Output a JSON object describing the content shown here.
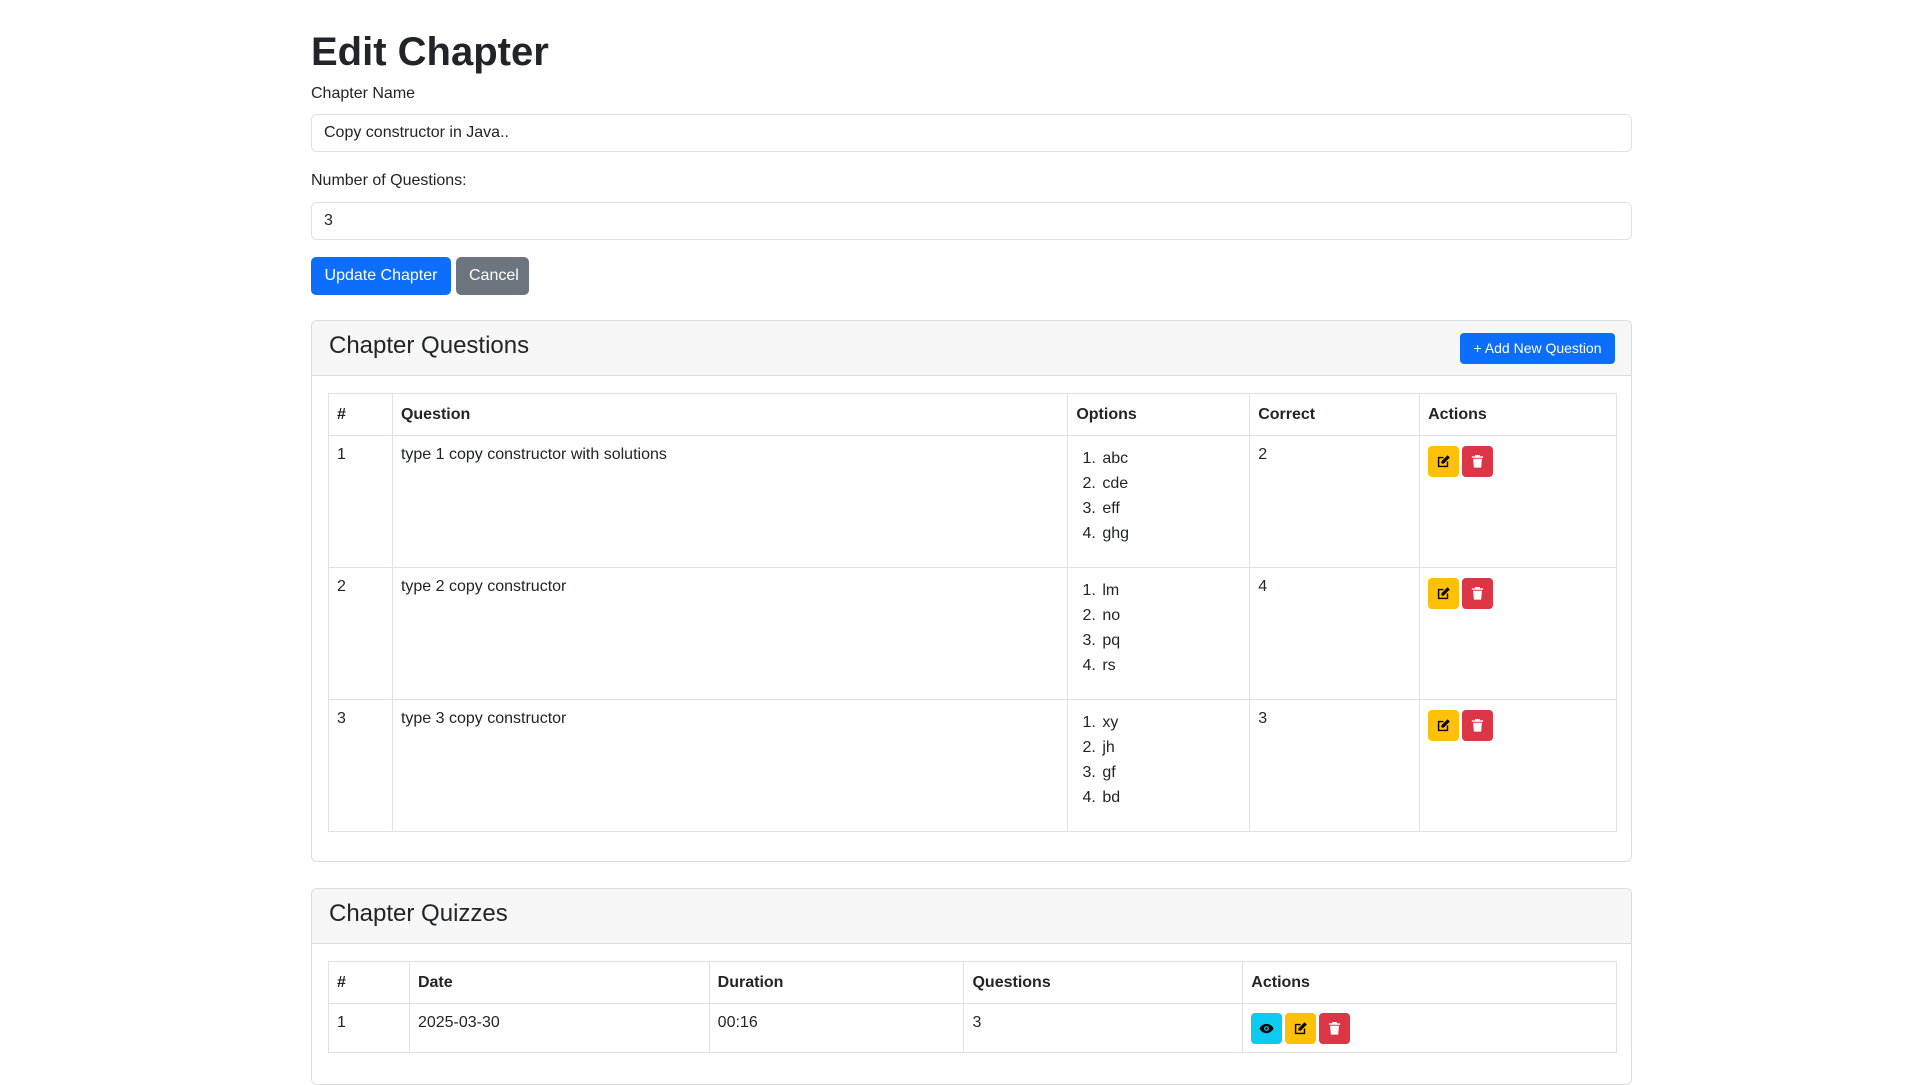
{
  "page": {
    "title": "Edit Chapter"
  },
  "form": {
    "chapter_name_label": "Chapter Name",
    "chapter_name_value": "Copy constructor in Java..",
    "num_questions_label": "Number of Questions:",
    "num_questions_value": "3",
    "update_label": "Update Chapter",
    "cancel_label": "Cancel"
  },
  "questions": {
    "title": "Chapter Questions",
    "add_label": "+ Add New Question",
    "columns": [
      "#",
      "Question",
      "Options",
      "Correct",
      "Actions"
    ],
    "rows": [
      {
        "num": "1",
        "question": "type 1 copy constructor with solutions",
        "options": [
          "abc",
          "cde",
          "eff",
          "ghg"
        ],
        "correct": "2"
      },
      {
        "num": "2",
        "question": "type 2 copy constructor",
        "options": [
          "lm",
          "no",
          "pq",
          "rs"
        ],
        "correct": "4"
      },
      {
        "num": "3",
        "question": "type 3 copy constructor",
        "options": [
          "xy",
          "jh",
          "gf",
          "bd"
        ],
        "correct": "3"
      }
    ],
    "row_actions": [
      "edit-icon",
      "trash-icon"
    ]
  },
  "quizzes": {
    "title": "Chapter Quizzes",
    "columns": [
      "#",
      "Date",
      "Duration",
      "Questions",
      "Actions"
    ],
    "rows": [
      {
        "num": "1",
        "date": "2025-03-30",
        "duration": "00:16",
        "questions": "3"
      }
    ],
    "row_actions": [
      "eye-icon",
      "edit-icon",
      "trash-icon"
    ]
  },
  "colors": {
    "primary": "#0d6efd",
    "secondary": "#6c757d",
    "warning": "#ffc107",
    "danger": "#dc3545",
    "info": "#0dcaf0"
  }
}
